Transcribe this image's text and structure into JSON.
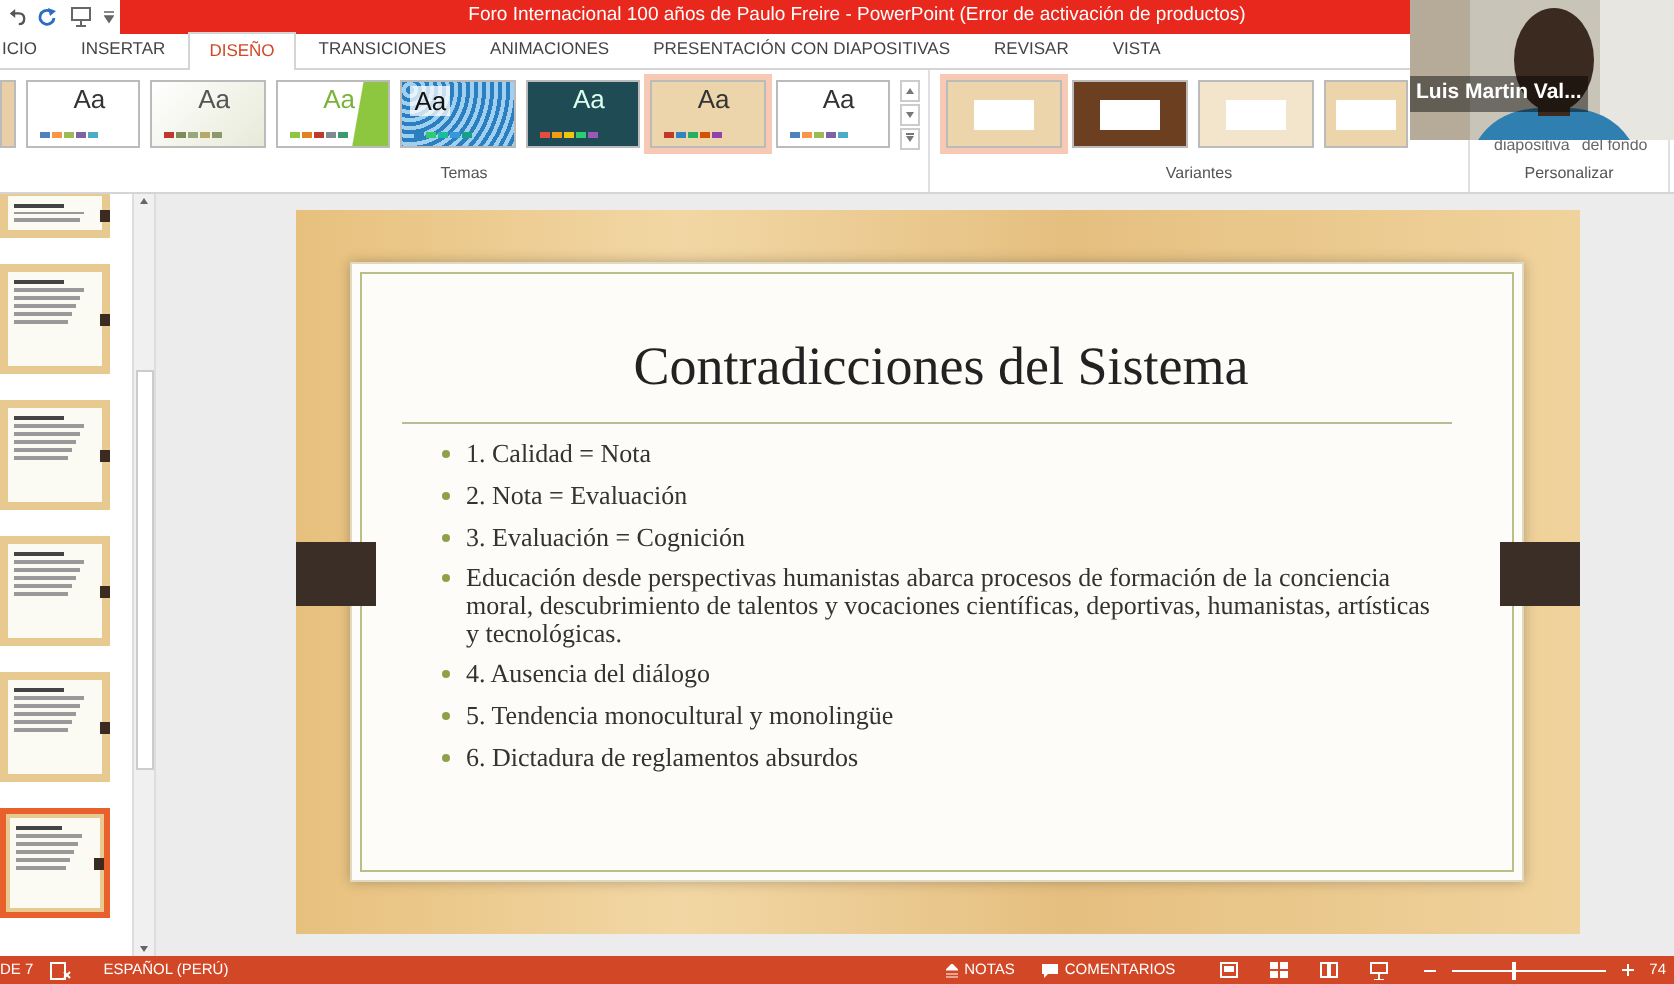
{
  "window": {
    "title": "Foro Internacional 100 años de Paulo Freire -  PowerPoint (Error de activación de productos)"
  },
  "tabs": [
    {
      "label": "ICIO",
      "selected": false
    },
    {
      "label": "INSERTAR",
      "selected": false
    },
    {
      "label": "DISEÑO",
      "selected": true
    },
    {
      "label": "TRANSICIONES",
      "selected": false
    },
    {
      "label": "ANIMACIONES",
      "selected": false
    },
    {
      "label": "PRESENTACIÓN CON DIAPOSITIVAS",
      "selected": false
    },
    {
      "label": "REVISAR",
      "selected": false
    },
    {
      "label": "VISTA",
      "selected": false
    }
  ],
  "themes": {
    "items": [
      {
        "kind": "white",
        "label": "Aa",
        "selected": false
      },
      {
        "kind": "sage",
        "label": "Aa",
        "selected": false
      },
      {
        "kind": "green",
        "label": "Aa",
        "selected": false
      },
      {
        "kind": "pattern",
        "label": "Aa",
        "selected": false
      },
      {
        "kind": "dark",
        "label": "Aa",
        "selected": false
      },
      {
        "kind": "wood",
        "label": "Aa",
        "selected": true
      },
      {
        "kind": "white",
        "label": "Aa",
        "selected": false
      }
    ],
    "group_label": "Temas"
  },
  "variants": {
    "items": [
      {
        "kind": "wood",
        "selected": true
      },
      {
        "kind": "brown",
        "selected": false
      },
      {
        "kind": "cream",
        "selected": false
      },
      {
        "kind": "wood",
        "selected": false
      }
    ],
    "group_label": "Variantes"
  },
  "customize": {
    "button_texts": [
      "diapositiva",
      "del fondo"
    ],
    "group_label": "Personalizar"
  },
  "video": {
    "name": "Luis Martin Val..."
  },
  "slides_pane": {
    "thumbnails": [
      {
        "selected": false
      },
      {
        "selected": false
      },
      {
        "selected": false
      },
      {
        "selected": false
      },
      {
        "selected": false
      },
      {
        "selected": true
      }
    ]
  },
  "slide": {
    "title": "Contradicciones del Sistema",
    "bullets": [
      "1. Calidad = Nota",
      "2. Nota = Evaluación",
      "3. Evaluación = Cognición",
      "Educación desde perspectivas humanistas abarca procesos de formación de la conciencia moral, descubrimiento de talentos y vocaciones científicas, deportivas, humanistas, artísticas y tecnológicas.",
      "4. Ausencia del diálogo",
      "5. Tendencia monocultural y monolingüe",
      "6. Dictadura de reglamentos absurdos"
    ]
  },
  "status_bar": {
    "slide_number": "DE 7",
    "language": "ESPAÑOL (PERÚ)",
    "notes": "NOTAS",
    "comments": "COMENTARIOS",
    "zoom_slider": {
      "level": 0.4
    },
    "zoom": "74"
  }
}
